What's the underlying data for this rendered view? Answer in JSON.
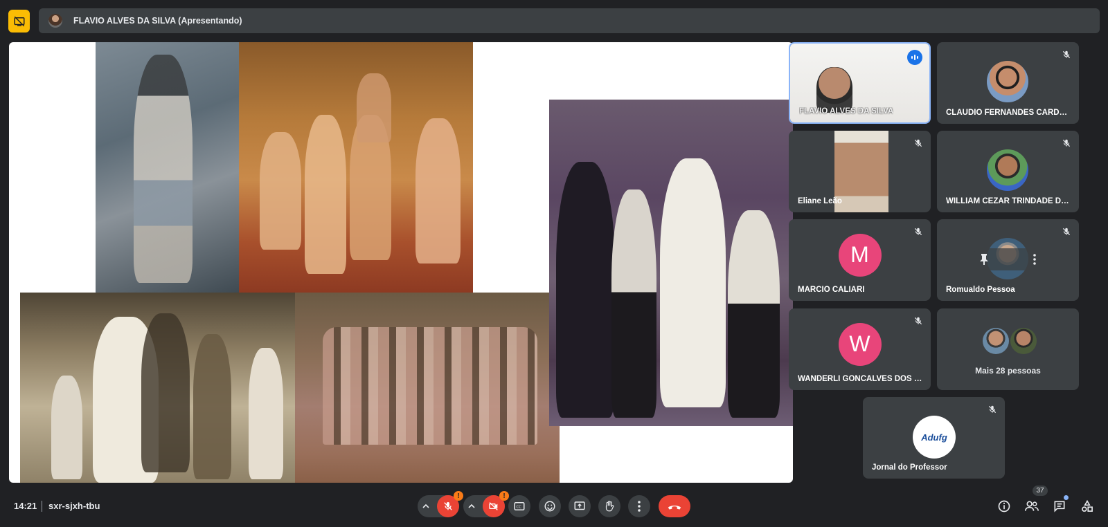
{
  "presenter": {
    "name": "FLAVIO ALVES DA SILVA (Apresentando)"
  },
  "participants": [
    {
      "name": "FLAVIO ALVES DA SILVA"
    },
    {
      "name": "CLAUDIO FERNANDES CARDOSO"
    },
    {
      "name": "Eliane Leão"
    },
    {
      "name": "WILLIAM CEZAR TRINDADE DOS SANTOS"
    },
    {
      "name": "MARCIO CALIARI",
      "initial": "M"
    },
    {
      "name": "Romualdo Pessoa"
    },
    {
      "name": "WANDERLI GONCALVES DOS SANTOS",
      "initial": "W"
    },
    {
      "name": "Mais 28 pessoas"
    },
    {
      "name": "Jornal do Professor",
      "logo": "Adufg"
    }
  ],
  "meeting": {
    "time": "14:21",
    "code": "sxr-sjxh-tbu",
    "people_count": "37"
  },
  "controls": {
    "warning_mark": "!"
  },
  "colors": {
    "accent": "#8ab4f8",
    "avatar_pink": "#e8457a",
    "leave_red": "#ea4335",
    "present_yellow": "#fbbc04"
  },
  "icons": [
    "present-stop-icon",
    "mic-off-icon",
    "camera-off-icon",
    "captions-icon",
    "emoji-icon",
    "present-icon",
    "raise-hand-icon",
    "more-icon",
    "call-end-icon",
    "info-icon",
    "people-icon",
    "chat-icon",
    "activities-icon",
    "speaking-icon",
    "pin-icon"
  ]
}
